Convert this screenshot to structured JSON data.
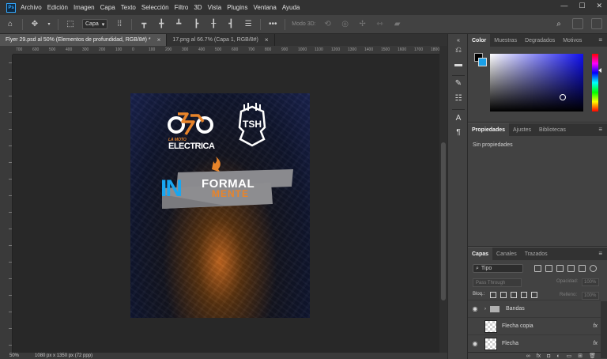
{
  "menu": {
    "logo": "Ps",
    "items": [
      "Archivo",
      "Edición",
      "Imagen",
      "Capa",
      "Texto",
      "Selección",
      "Filtro",
      "3D",
      "Vista",
      "Plugins",
      "Ventana",
      "Ayuda"
    ],
    "window_buttons": [
      "—",
      "☐",
      "✕"
    ]
  },
  "options": {
    "layer_select": "Capa",
    "mode_3d": "Modo 3D:"
  },
  "tabs": [
    {
      "label": "Flyer 29.psd al 50% (Elementos de profundidad, RGB/8#) *",
      "close": "×"
    },
    {
      "label": "17.png al 66.7% (Capa 1, RGB/8#)",
      "close": "×"
    }
  ],
  "ruler_top": [
    "700",
    "600",
    "500",
    "400",
    "300",
    "200",
    "100",
    "0",
    "100",
    "200",
    "300",
    "400",
    "500",
    "600",
    "700",
    "800",
    "900",
    "1000",
    "1100",
    "1200",
    "1300",
    "1400",
    "1500",
    "1600",
    "1700",
    "1800"
  ],
  "flyer": {
    "brand_small": "LA MOTO",
    "brand_main": "ELECTRICA",
    "badge": "TSH",
    "headline_in": "IN",
    "headline_formal": "FORMAL",
    "headline_mente": "MENTE",
    "orange": "#e8842a",
    "blue": "#19a6f0"
  },
  "status": {
    "zoom": "50%",
    "doc_size": "1080 px x 1350 px (72 ppp)"
  },
  "color_panel": {
    "tabs": [
      "Color",
      "Muestras",
      "Degradados",
      "Motivos"
    ],
    "foreground": "#000000",
    "background": "#1aa0e8"
  },
  "properties_panel": {
    "tabs": [
      "Propiedades",
      "Ajustes",
      "Bibliotecas"
    ],
    "empty_text": "Sin propiedades"
  },
  "layers_panel": {
    "tabs": [
      "Capas",
      "Canales",
      "Trazados"
    ],
    "filter_label": "Tipo",
    "blend_mode": "Pass Through",
    "opacity_label": "Opacidad:",
    "opacity_value": "100%",
    "lock_label": "Bloq.:",
    "fill_label": "Relleno:",
    "fill_value": "100%",
    "layers": [
      {
        "name": "Bandas",
        "type": "group",
        "visible": true
      },
      {
        "name": "Flecha copia",
        "type": "layer",
        "visible": false,
        "fx": "fx"
      },
      {
        "name": "Flecha",
        "type": "layer",
        "visible": true,
        "fx": "fx"
      }
    ],
    "footer_icons": [
      "link-icon",
      "fx-icon",
      "mask-icon",
      "adjustment-icon",
      "folder-icon",
      "new-layer-icon",
      "trash-icon"
    ]
  }
}
